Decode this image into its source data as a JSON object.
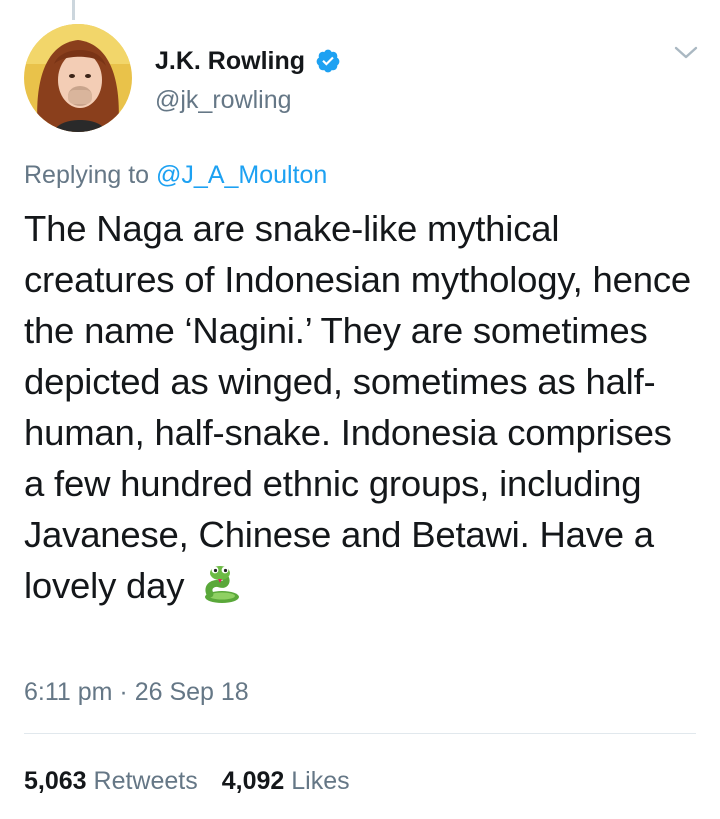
{
  "tweet": {
    "author": {
      "display_name": "J.K. Rowling",
      "handle": "@jk_rowling",
      "verified": true
    },
    "reply": {
      "prefix": "Replying to ",
      "user": "@J_A_Moulton"
    },
    "text": "The Naga are snake-like mythical creatures of Indonesian mythology, hence the name ‘Nagini.’ They are sometimes depicted as winged, sometimes as half-human, half-snake. Indonesia comprises a few hundred ethnic groups, including Javanese, Chinese and Betawi. Have a lovely day",
    "emoji": "snake-emoji",
    "timestamp": "6:11 pm · 26 Sep 18",
    "stats": {
      "retweets_count": "5,063",
      "retweets_label": "Retweets",
      "likes_count": "4,092",
      "likes_label": "Likes"
    }
  },
  "icons": {
    "verified": "verified-badge-icon",
    "more": "chevron-down-icon"
  },
  "colors": {
    "text": "#14171a",
    "secondary": "#657786",
    "accent": "#1da1f2",
    "divider": "#e1e8ed"
  }
}
